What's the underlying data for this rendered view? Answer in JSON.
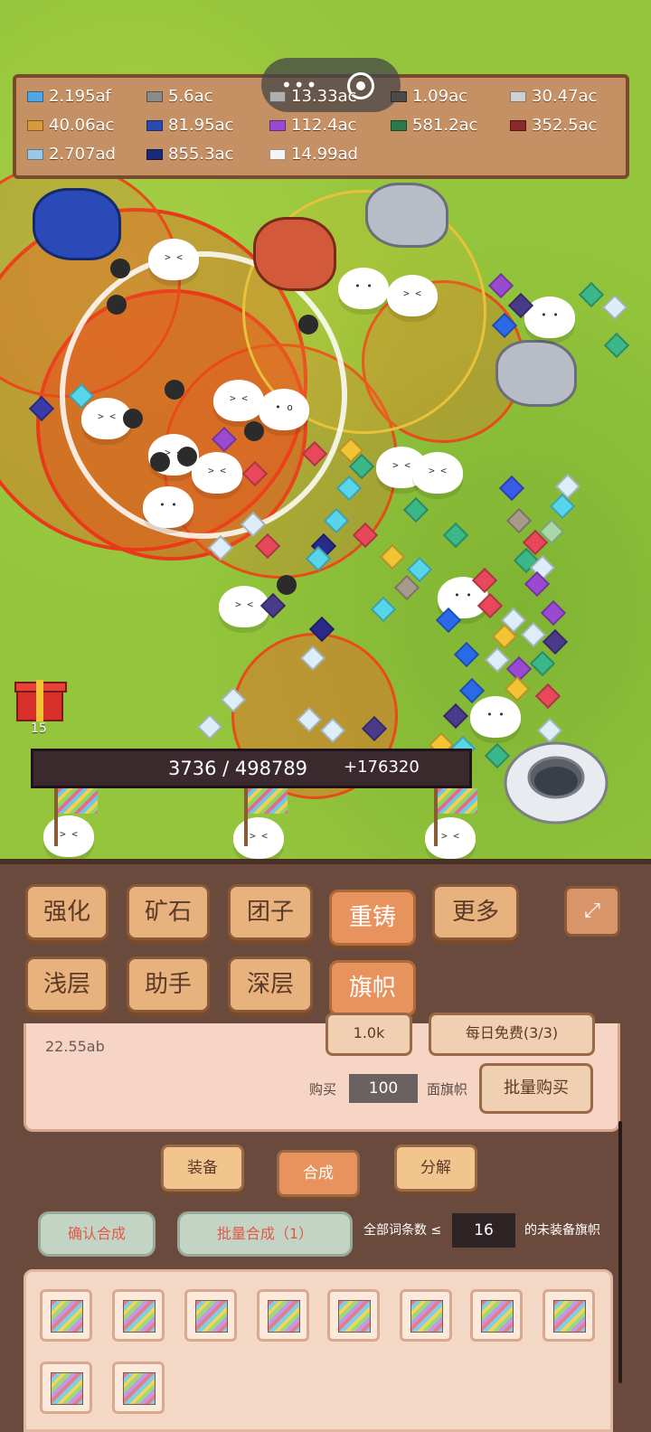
{
  "resources": [
    {
      "value": "2.195af",
      "color": "#4fa6e8",
      "icon": "diamond-gem-icon"
    },
    {
      "value": "5.6ac",
      "color": "#8a8a8a",
      "icon": "stone-ingot-icon"
    },
    {
      "value": "13.33ac",
      "color": "#b0b0b0",
      "icon": "iron-ingot-icon"
    },
    {
      "value": "1.09ac",
      "color": "#4a4a4a",
      "icon": "coal-ingot-icon"
    },
    {
      "value": "30.47ac",
      "color": "#d0d0d0",
      "icon": "silver-ingot-icon"
    },
    {
      "value": "40.06ac",
      "color": "#d89a3a",
      "icon": "copper-ingot-icon"
    },
    {
      "value": "81.95ac",
      "color": "#2a4ab0",
      "icon": "lapis-ingot-icon"
    },
    {
      "value": "112.4ac",
      "color": "#9a4ad0",
      "icon": "amethyst-ingot-icon"
    },
    {
      "value": "581.2ac",
      "color": "#2a7a4a",
      "icon": "emerald-ingot-icon"
    },
    {
      "value": "352.5ac",
      "color": "#8a2a2a",
      "icon": "ruby-ingot-icon"
    },
    {
      "value": "2.707ad",
      "color": "#9ac8e8",
      "icon": "crystal-ingot-icon"
    },
    {
      "value": "855.3ac",
      "color": "#1a2a7a",
      "icon": "sapphire-ingot-icon"
    },
    {
      "value": "14.99ad",
      "color": "#f4f4f4",
      "icon": "white-ingot-icon"
    }
  ],
  "gift": {
    "count": "15"
  },
  "progress": {
    "text": "3736 / 498789",
    "increment": "+176320",
    "fraction": 0.0075
  },
  "tabs": {
    "row1": [
      "强化",
      "矿石",
      "团子",
      "重铸",
      "更多"
    ],
    "row2": [
      "浅层",
      "助手",
      "深层",
      "旗帜"
    ],
    "active": "旗帜"
  },
  "expand_icon": "expand-icon",
  "card": {
    "value": "22.55ab",
    "price_partial": "1.0k",
    "free_partial": "每日免费(3/3)",
    "buy_label": "购买",
    "buy_qty": "100",
    "buy_unit": "面旗帜",
    "bulk_buy": "批量购买"
  },
  "subtabs": {
    "items": [
      "装备",
      "合成",
      "分解"
    ],
    "active": "合成"
  },
  "synth": {
    "confirm": "确认合成",
    "bulk": "批量合成（1）",
    "filter_label": "全部词条数 ≤",
    "filter_value": "16",
    "filter_suffix": "的未装备旗帜"
  },
  "colors": {
    "accent": "#e8935e",
    "panel": "#6b4a3e",
    "tab": "#e8b27f"
  }
}
